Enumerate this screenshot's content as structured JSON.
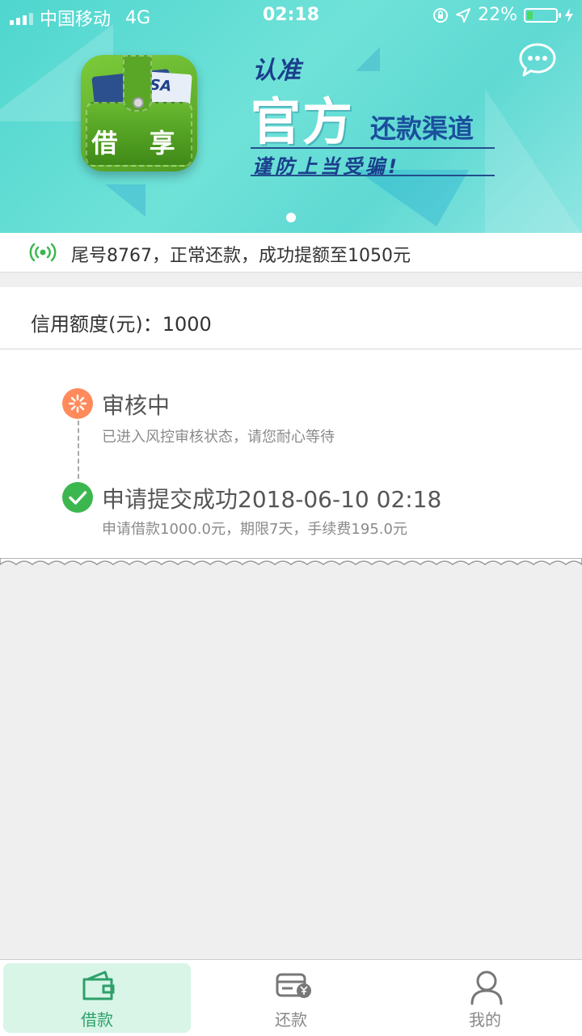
{
  "status_bar": {
    "carrier": "中国移动",
    "network": "4G",
    "time": "02:18",
    "battery": "22%",
    "battery_level": 0.22
  },
  "banner": {
    "app_name": "借 享",
    "card_text": "ISA",
    "slogan_line1": "认准",
    "slogan_big": "官方",
    "slogan_tail": "还款渠道",
    "slogan_warn": "谨防上当受骗!",
    "slide_count": 1
  },
  "notice": {
    "text": "尾号8767，正常还款，成功提额至1050元"
  },
  "credit": {
    "label": "信用额度(元)：1000"
  },
  "steps": [
    {
      "title": "审核中",
      "subtitle": "已进入风控审核状态，请您耐心等待",
      "status": "pending",
      "color": "#ff8a5c"
    },
    {
      "title": "申请提交成功2018-06-10 02:18",
      "subtitle": "申请借款1000.0元，期限7天，手续费195.0元",
      "status": "done",
      "color": "#3cb74f"
    }
  ],
  "tabbar": {
    "items": [
      {
        "label": "借款",
        "icon": "wallet-icon",
        "active": true
      },
      {
        "label": "还款",
        "icon": "repay-card-icon",
        "active": false
      },
      {
        "label": "我的",
        "icon": "user-icon",
        "active": false
      }
    ],
    "active_color": "#2ea06a",
    "active_bg": "#d8f5e8"
  }
}
